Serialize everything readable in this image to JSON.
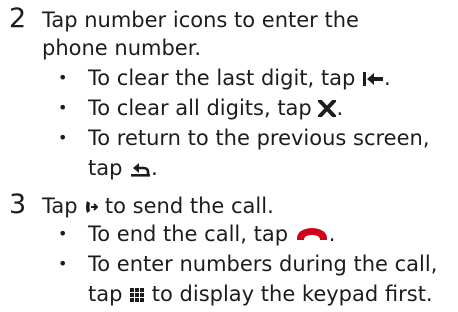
{
  "step2": {
    "number": "2",
    "intro_line1": "Tap number icons to enter the",
    "intro_line2": "phone number.",
    "bullets": [
      {
        "before": "To clear the last digit, tap ",
        "icon": "backspace-icon",
        "after": "."
      },
      {
        "before": "To clear all digits, tap ",
        "icon": "clear-x-icon",
        "after": "."
      },
      {
        "line1": "To return to the previous screen,",
        "before": "tap ",
        "icon": "return-arrow-icon",
        "after": "."
      }
    ]
  },
  "step3": {
    "number": "3",
    "intro_before": "Tap ",
    "intro_icon": "call-send-icon",
    "intro_after": " to send the call.",
    "bullets": [
      {
        "before": "To end the call, tap ",
        "icon": "end-call-handset-icon",
        "after": "."
      },
      {
        "line1": "To enter numbers during the call,",
        "before": "tap ",
        "icon": "keypad-grid-icon",
        "after": " to display the keypad first."
      }
    ]
  },
  "bullet_symbol": "•",
  "colors": {
    "text": "#1c1c1c",
    "end_call": "#d0021b"
  }
}
